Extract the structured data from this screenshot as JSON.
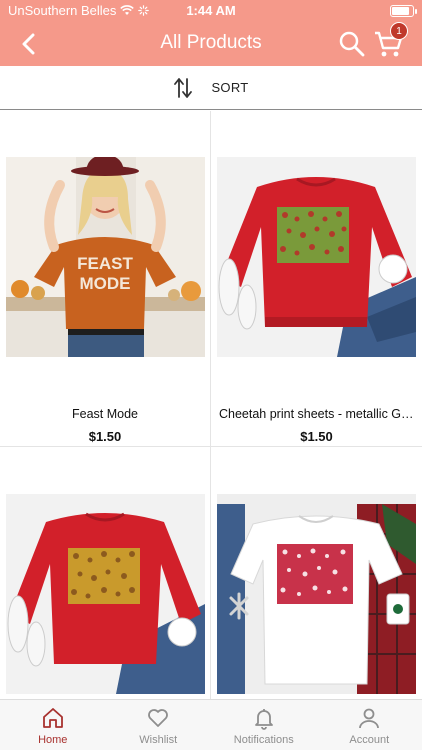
{
  "status_bar": {
    "carrier": "UnSouthern Belles",
    "time": "1:44 AM"
  },
  "header": {
    "title": "All Products",
    "cart_count": "1"
  },
  "sort": {
    "label": "SORT"
  },
  "products": [
    {
      "name": "Feast Mode",
      "price": "$1.50"
    },
    {
      "name": "Cheetah print sheets - metallic Gold",
      "price": "$1.50"
    },
    {
      "name": "",
      "price": ""
    },
    {
      "name": "",
      "price": ""
    }
  ],
  "tabs": [
    {
      "label": "Home"
    },
    {
      "label": "Wishlist"
    },
    {
      "label": "Notifications"
    },
    {
      "label": "Account"
    }
  ],
  "colors": {
    "header": "#f5998a",
    "active_tab": "#a8322f",
    "badge": "#c0392b"
  }
}
